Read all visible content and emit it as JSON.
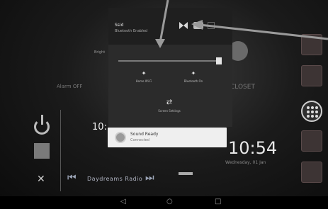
{
  "shade": {
    "title": "Ssid",
    "subtitle": "Bluetooth Enabled",
    "brightness_label": "Bright",
    "brightness_level": 0.95,
    "tiles": [
      {
        "icon": "wifi-icon",
        "label": "Home Wi-Fi"
      },
      {
        "icon": "bluetooth-icon",
        "label": "Bluetooth On"
      },
      {
        "icon": "settings-icon",
        "label": "Screen Settings"
      }
    ]
  },
  "notification": {
    "title": "Sound Ready",
    "subtitle": "Connected"
  },
  "media": {
    "label": "Daydreams Radio"
  },
  "time": {
    "small": "10:",
    "clock": "10:54",
    "clock_sub": "Wednesday, 01 Jan"
  },
  "labels": {
    "left": "Alarm\nOFF",
    "mid": "CLOSET"
  },
  "nav": {
    "back": "◁",
    "home": "○",
    "recent": "□"
  },
  "colors": {
    "shade_bg": "#2b2b2b",
    "card_bg": "#efefef"
  }
}
